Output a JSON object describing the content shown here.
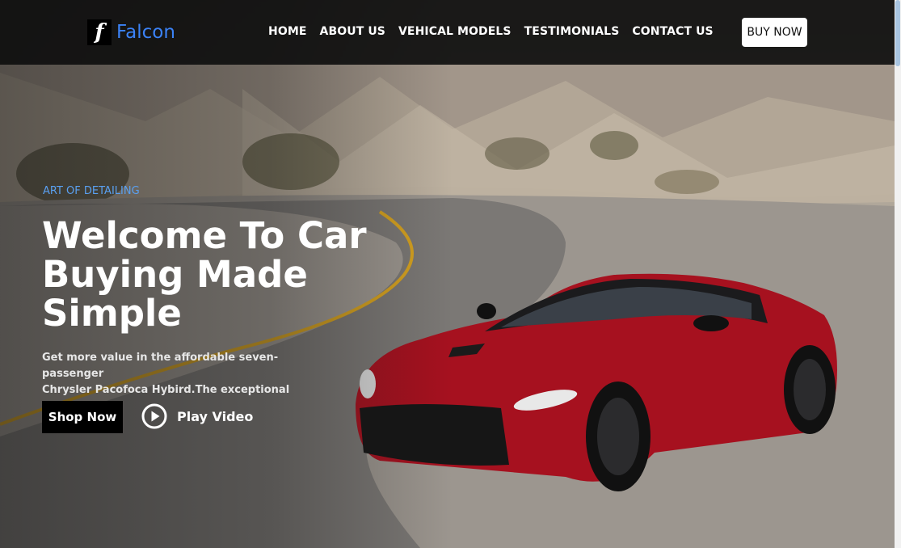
{
  "brand": {
    "mark": "f",
    "name": "Falcon"
  },
  "nav": {
    "items": [
      {
        "label": "HOME"
      },
      {
        "label": "ABOUT US"
      },
      {
        "label": "VEHICAL MODELS"
      },
      {
        "label": "TESTIMONIALS"
      },
      {
        "label": "CONTACT US"
      }
    ],
    "cta": "BUY NOW"
  },
  "hero": {
    "eyebrow": "ART OF DETAILING",
    "title_lines": [
      "Welcome To Car",
      "Buying Made",
      "Simple"
    ],
    "desc_lines": [
      "Get more value in the affordable seven-passenger",
      "Chrysler Pacofoca Hybird.The exceptional and"
    ],
    "shop_label": "Shop Now",
    "play_label": "Play Video",
    "play_icon": "play-circle-icon"
  },
  "colors": {
    "brand": "#3b82f6",
    "eyebrow": "#5aa0f0",
    "car": "#b3142a",
    "nav_bg": "#0f0f0f"
  }
}
